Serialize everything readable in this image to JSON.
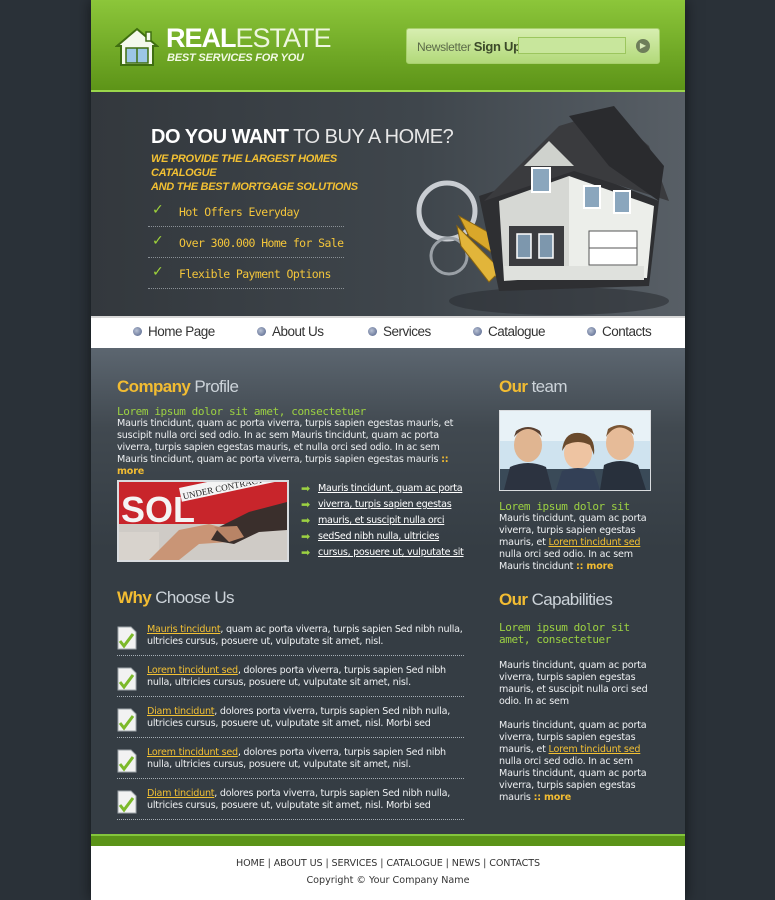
{
  "header": {
    "logo_bold": "REAL",
    "logo_light": "ESTATE",
    "tagline": "BEST SERVICES FOR YOU",
    "newsletter_light": "Newsletter",
    "newsletter_bold": "Sign Up",
    "newsletter_input_value": "",
    "go_icon": "arrow-right-icon"
  },
  "banner": {
    "title_bold": "DO YOU WANT",
    "title_light": "TO BUY A HOME?",
    "subtitle_line1": "WE PROVIDE THE LARGEST HOMES CATALOGUE",
    "subtitle_line2": "AND THE BEST MORTGAGE SOLUTIONS",
    "items": [
      "Hot Offers Everyday",
      "Over 300.000 Home for Sale",
      "Flexible Payment Options"
    ]
  },
  "nav": {
    "items": [
      "Home Page",
      "About Us",
      "Services",
      "Catalogue",
      "Contacts"
    ]
  },
  "company": {
    "heading_bold": "Company",
    "heading_light": "Profile",
    "lead": "Lorem ipsum dolor sit amet, consectetuer",
    "text": "Mauris tincidunt, quam ac porta viverra, turpis sapien egestas mauris, et suscipit nulla orci sed odio. In ac sem Mauris tincidunt, quam ac porta viverra, turpis sapien egestas mauris, et nulla orci sed odio. In ac sem Mauris tincidunt, quam ac porta viverra, turpis sapien egestas mauris",
    "more": ":: more",
    "photo_text": "SOL",
    "photo_banner": "UNDER CONTRACT CONT",
    "links": [
      "Mauris tincidunt, quam ac porta",
      "viverra, turpis sapien egestas",
      "mauris, et suscipit nulla orci",
      "sedSed nibh nulla, ultricies",
      "cursus, posuere ut, vulputate sit"
    ]
  },
  "why": {
    "heading_bold": "Why",
    "heading_light": "Choose Us",
    "rows": [
      {
        "link": "Mauris tincidunt",
        "text": ", quam ac porta viverra, turpis sapien  Sed nibh nulla, ultricies cursus, posuere ut, vulputate sit amet, nisl."
      },
      {
        "link": "Lorem tincidunt sed",
        "text": ", dolores porta viverra, turpis sapien Sed nibh nulla, ultricies cursus, posuere ut, vulputate sit amet, nisl."
      },
      {
        "link": "Diam tincidunt",
        "text": ", dolores porta viverra, turpis sapien Sed nibh nulla, ultricies cursus, posuere ut, vulputate sit amet, nisl. Morbi sed"
      },
      {
        "link": "Lorem tincidunt sed",
        "text": ", dolores porta viverra, turpis sapien Sed nibh nulla, ultricies cursus, posuere ut, vulputate sit amet, nisl."
      },
      {
        "link": "Diam tincidunt",
        "text": ", dolores porta viverra, turpis sapien Sed nibh nulla, ultricies cursus, posuere ut, vulputate sit amet, nisl. Morbi sed"
      }
    ]
  },
  "team": {
    "heading_bold": "Our",
    "heading_light": "team",
    "lead": "Lorem ipsum dolor sit",
    "text_before": "Mauris tincidunt, quam ac porta viverra, turpis sapien egestas mauris, et ",
    "link": "Lorem tincidunt sed",
    "text_after": " nulla orci sed odio. In ac sem Mauris tincidunt ",
    "more": ":: more"
  },
  "capabilities": {
    "heading_bold": "Our",
    "heading_light": "Capabilities",
    "lead": "Lorem ipsum dolor sit amet, consectetuer",
    "para1": "Mauris tincidunt, quam ac porta viverra, turpis sapien egestas mauris, et suscipit nulla orci sed odio. In ac sem",
    "para2_before": "Mauris tincidunt, quam ac porta viverra, turpis sapien egestas mauris, et ",
    "para2_link": "Lorem tincidunt sed",
    "para2_after": " nulla orci sed odio. In ac sem Mauris tincidunt, quam ac porta viverra, turpis sapien egestas mauris ",
    "more": ":: more"
  },
  "footer": {
    "links": [
      "HOME",
      "ABOUT US",
      "SERVICES",
      "CATALOGUE",
      "NEWS",
      "CONTACTS"
    ],
    "separator": "|",
    "copyright": "Copyright © Your Company Name"
  }
}
